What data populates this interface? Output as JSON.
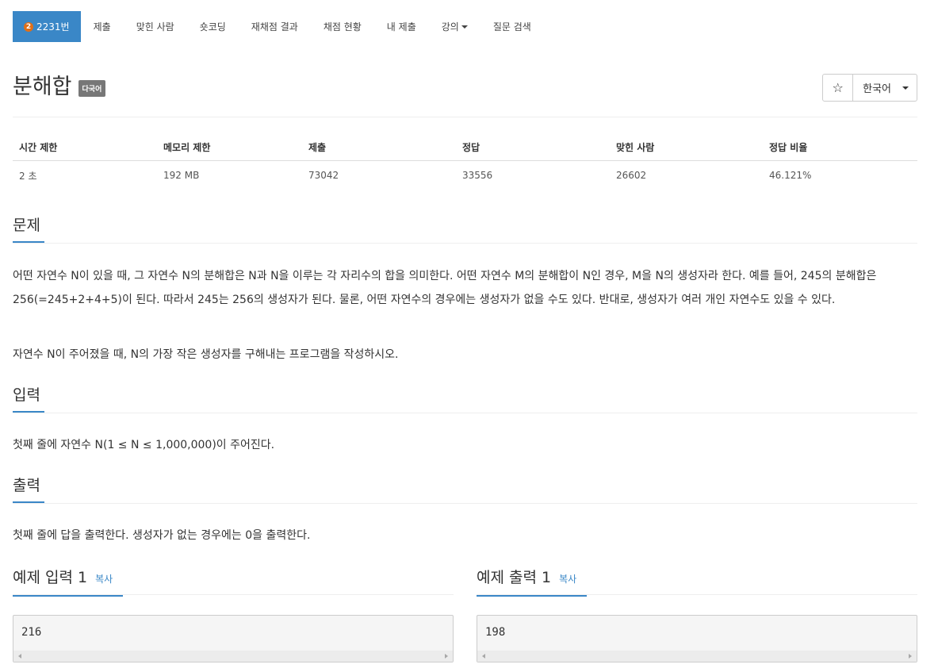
{
  "nav": {
    "problem_tab": {
      "tier_icon": "tier-badge-icon",
      "tier_text": "2",
      "label": "2231번"
    },
    "items": [
      {
        "id": "submit",
        "label": "제출"
      },
      {
        "id": "solvers",
        "label": "맞힌 사람"
      },
      {
        "id": "shortcoding",
        "label": "숏코딩"
      },
      {
        "id": "rejudge",
        "label": "재채점 결과"
      },
      {
        "id": "status",
        "label": "채점 현황"
      },
      {
        "id": "my-submissions",
        "label": "내 제출"
      },
      {
        "id": "lectures",
        "label": "강의"
      },
      {
        "id": "questions",
        "label": "질문 검색"
      }
    ]
  },
  "problem": {
    "title": "분해합",
    "lang_badge": "다국어",
    "star_icon": "☆",
    "language_select": "한국어"
  },
  "info": {
    "headers": [
      "시간 제한",
      "메모리 제한",
      "제출",
      "정답",
      "맞힌 사람",
      "정답 비율"
    ],
    "values": [
      "2 초",
      "192 MB",
      "73042",
      "33556",
      "26602",
      "46.121%"
    ]
  },
  "sections": {
    "description": {
      "title": "문제",
      "p1": "어떤 자연수 N이 있을 때, 그 자연수 N의 분해합은 N과 N을 이루는 각 자리수의 합을 의미한다. 어떤 자연수 M의 분해합이 N인 경우, M을 N의 생성자라 한다. 예를 들어, 245의 분해합은 256(=245+2+4+5)이 된다. 따라서 245는 256의 생성자가 된다. 물론, 어떤 자연수의 경우에는 생성자가 없을 수도 있다. 반대로, 생성자가 여러 개인 자연수도 있을 수 있다.",
      "p2": "자연수 N이 주어졌을 때, N의 가장 작은 생성자를 구해내는 프로그램을 작성하시오."
    },
    "input": {
      "title": "입력",
      "text": "첫째 줄에 자연수 N(1 ≤ N ≤ 1,000,000)이 주어진다."
    },
    "output": {
      "title": "출력",
      "text": "첫째 줄에 답을 출력한다. 생성자가 없는 경우에는 0을 출력한다."
    }
  },
  "samples": {
    "input": {
      "title": "예제 입력 1",
      "copy": "복사",
      "value": "216"
    },
    "output": {
      "title": "예제 출력 1",
      "copy": "복사",
      "value": "198"
    }
  }
}
